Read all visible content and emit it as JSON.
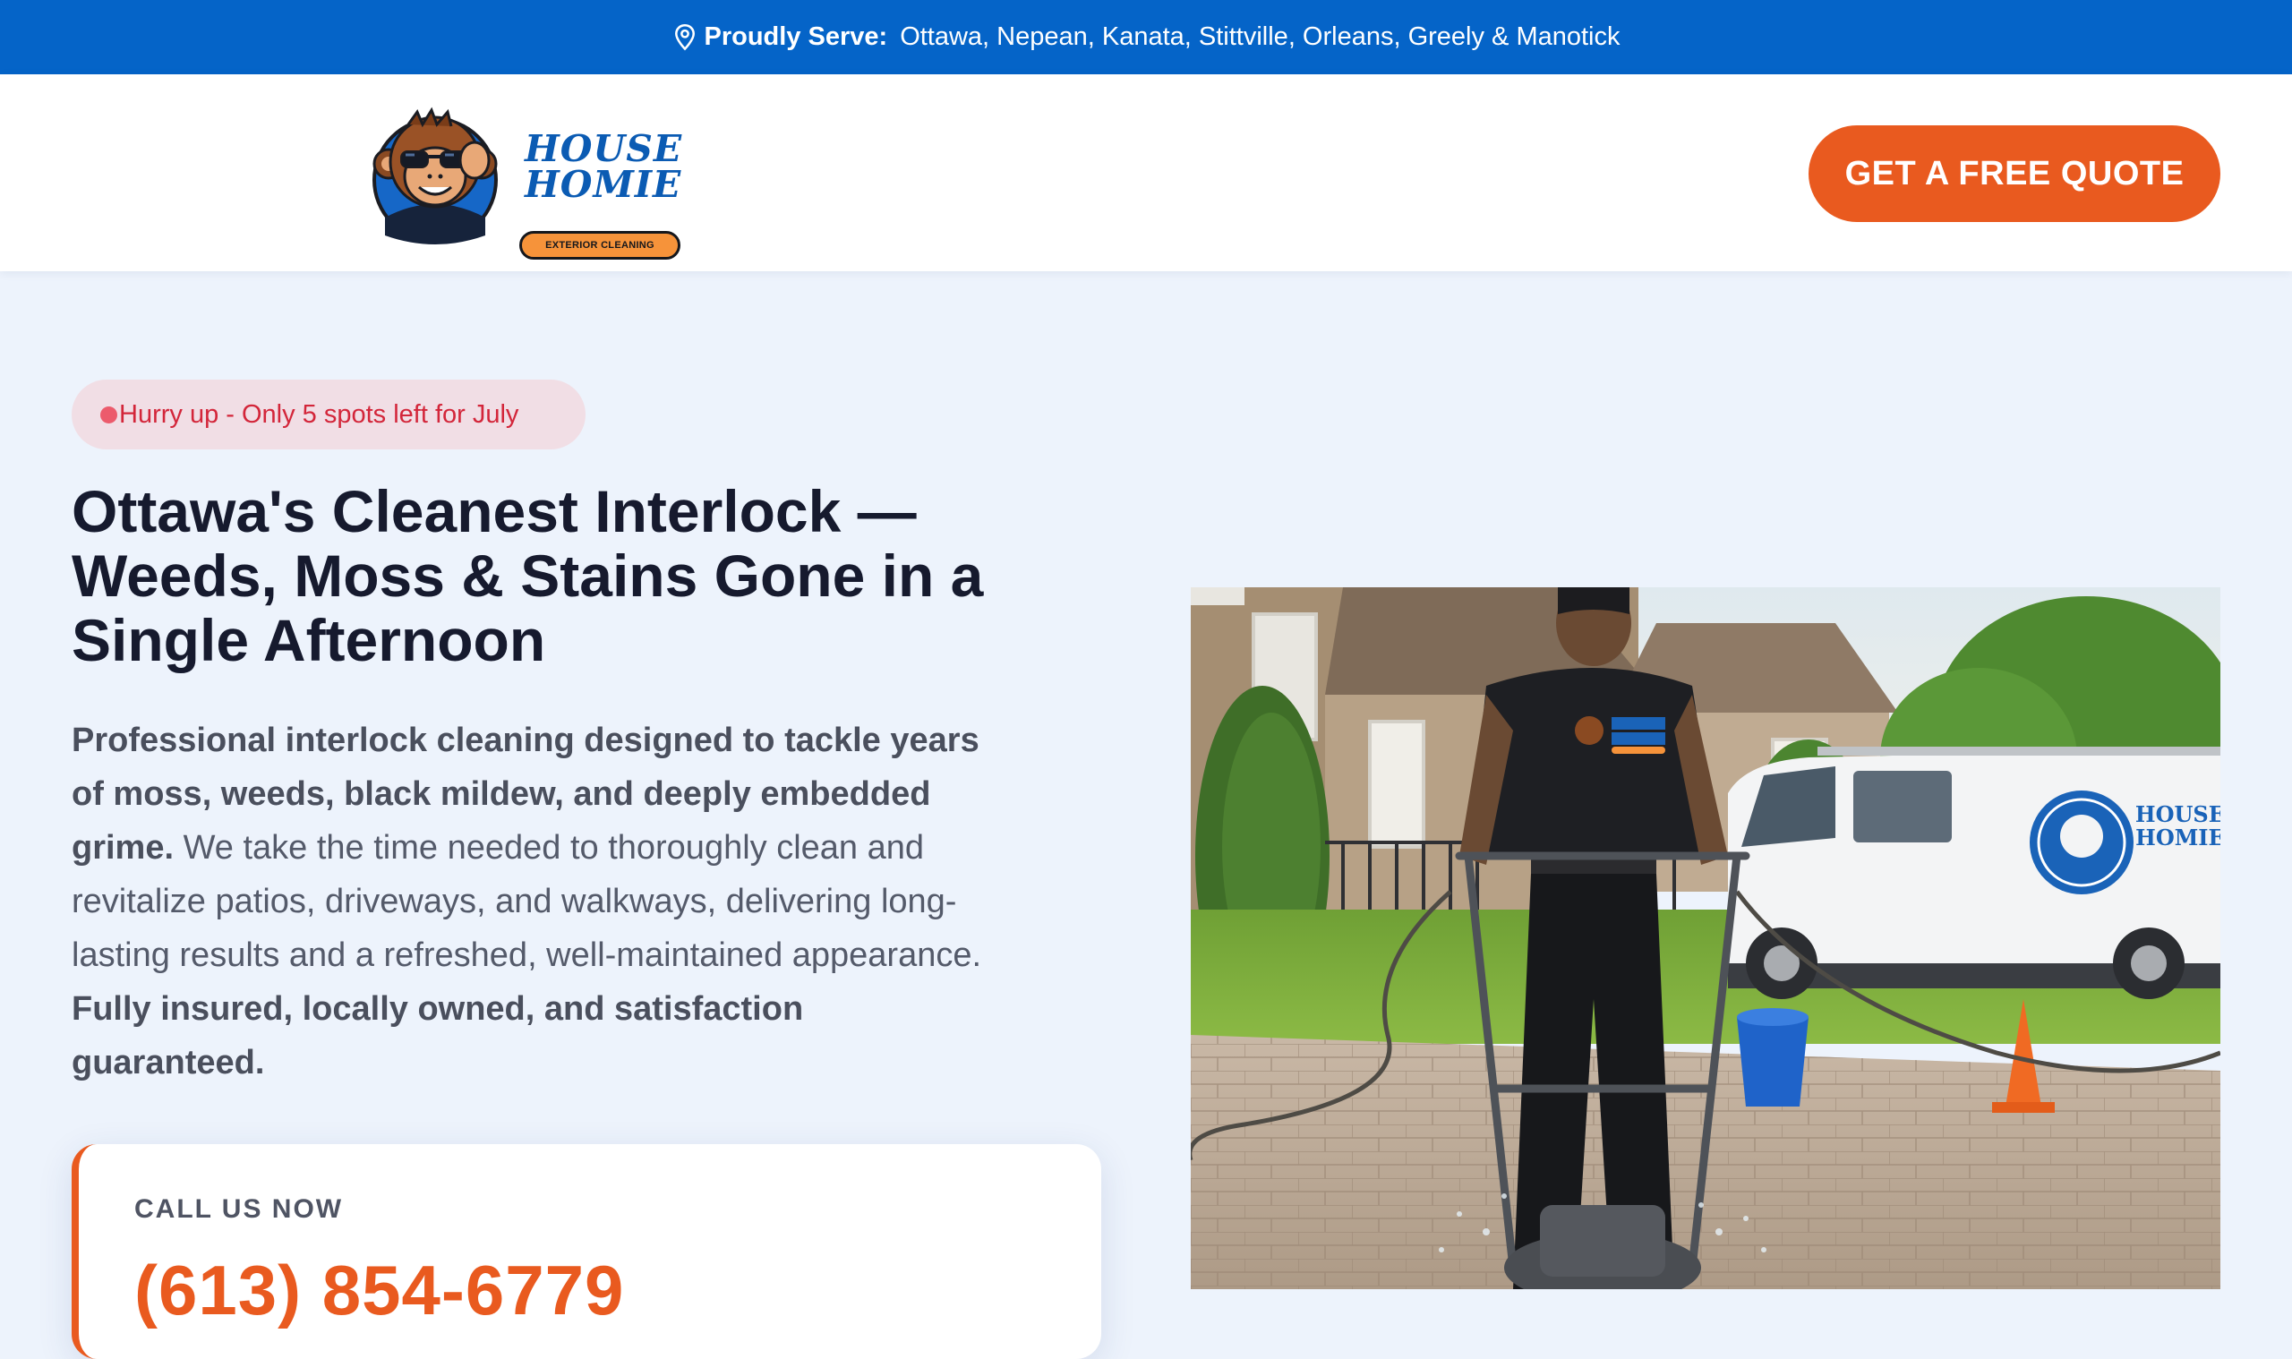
{
  "topbar": {
    "icon": "map-pin-icon",
    "serve_label": "Proudly Serve:",
    "serve_areas": "Ottawa, Nepean, Kanata, Stittville, Orleans, Greely & Manotick"
  },
  "header": {
    "logo": {
      "line1": "HOUSE",
      "line2": "HOMIE",
      "tagline": "EXTERIOR CLEANING"
    },
    "cta_label": "GET A FREE QUOTE"
  },
  "hero": {
    "urgency_text": "Hurry up - Only 5 spots left for July",
    "headline": "Ottawa's Cleanest Interlock — Weeds, Moss & Stains Gone in a Single Afternoon",
    "lead": {
      "bold_intro": "Professional interlock cleaning designed to tackle years of moss, weeds, black mildew, and deeply embedded grime.",
      "body": " We take the time needed to thoroughly clean and revitalize patios, driveways, and walkways, delivering long-lasting results and a refreshed, well-maintained appearance. ",
      "bold_outro": "Fully insured, locally owned, and satisfaction guaranteed."
    },
    "call": {
      "label": "CALL US NOW",
      "phone": "(613) 854-6779"
    },
    "van_logo": {
      "line1": "HOUSE",
      "line2": "HOMIE"
    }
  },
  "colors": {
    "topbar": "#0564c8",
    "accent_orange": "#e95a1f",
    "urgency_red": "#d3263a",
    "page_bg": "#edf3fc",
    "brand_blue": "#0b5bb3"
  }
}
